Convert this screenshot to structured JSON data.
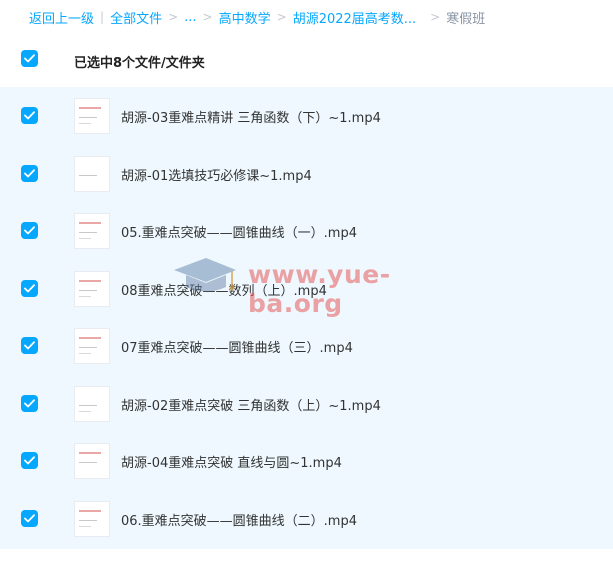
{
  "breadcrumb": {
    "back": "返回上一级",
    "sep": "|",
    "all_files": "全部文件",
    "ellipsis": "...",
    "arrow": ">",
    "level1": "高中数学",
    "level2": "胡源2022届高考数...",
    "current": "寒假班"
  },
  "header": {
    "selected_text": "已选中8个文件/文件夹"
  },
  "files": [
    {
      "name": "胡源-03重难点精讲 三角函数（下）~1.mp4"
    },
    {
      "name": "胡源-01选填技巧必修课~1.mp4"
    },
    {
      "name": "05.重难点突破——圆锥曲线（一）.mp4"
    },
    {
      "name": "08重难点突破——数列（上）.mp4"
    },
    {
      "name": "07重难点突破——圆锥曲线（三）.mp4"
    },
    {
      "name": "胡源-02重难点突破 三角函数（上）~1.mp4"
    },
    {
      "name": "胡源-04重难点突破 直线与圆~1.mp4"
    },
    {
      "name": "06.重难点突破——圆锥曲线（二）.mp4"
    }
  ],
  "watermark": {
    "text": "www.yue-ba.org"
  },
  "colors": {
    "accent": "#06a7ff",
    "selected_bg": "#eef8fe",
    "current_crumb": "#8a94a6"
  }
}
